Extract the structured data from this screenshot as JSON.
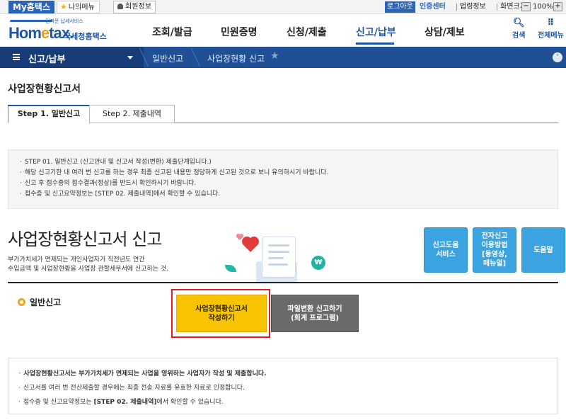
{
  "topbar": {
    "my_hometax": "My홈택스",
    "my_menu": "나의메뉴",
    "member_info": "회원정보",
    "logout": "로그아웃",
    "cert_center": "인증센터",
    "law_info": "법령정보",
    "screen_size": "화면크기",
    "zoom_out": "−",
    "zoom_value": "100%",
    "zoom_in": "+"
  },
  "header": {
    "logo_small": "전자문 납세서비스",
    "logo_main_pre": "Hom",
    "logo_main_e": "e",
    "logo_main_post": "tax.",
    "logo_sub": "국세청홈택스",
    "nav": [
      "조회/발급",
      "민원증명",
      "신청/제출",
      "신고/납부",
      "상담/제보"
    ],
    "search_label": "검색",
    "all_menu_label": "전체메뉴",
    "active_color": "#1f57a6"
  },
  "location": {
    "menu_title": "신고/납부",
    "crumb1": "일반신고",
    "crumb2": "사업장현황 신고",
    "expand_icon": "˅"
  },
  "page": {
    "title": "사업장현황신고서",
    "tabs": [
      {
        "label": "Step 1. 일반신고",
        "active": true
      },
      {
        "label": "Step 2. 제출내역",
        "active": false
      }
    ]
  },
  "info": {
    "lines": [
      "STEP 01. 일반신고 (신고안내 및 신고서 작성(변환) 제출단계입니다.)",
      "해당 신고기한 내 여러 번 신고를 하는 경우 최종 신고된 내용만 정당하게 신고된 것으로 보니 유의하시기 바랍니다.",
      "신고 후 접수증의 접수결과(정상)를 반드시 확인하시기 바랍니다.",
      "접수증 및 신고요약정보는 [STEP 02. 제출내역]에서 확인할 수 있습니다."
    ]
  },
  "hero": {
    "title": "사업장현황신고서 신고",
    "desc_line1": "부가가치세가 면제되는 개인사업자가 직전년도 연간",
    "desc_line2": "수입금액 및 사업장현황을 사업장 관할세무서에 신고하는 것.",
    "coin_symbol": "₩",
    "side_buttons": [
      "신고도움\n서비스",
      "전자신고\n이용방법\n[동영상,\n매뉴얼]",
      "도움말"
    ],
    "accent_color": "#3aa3e0"
  },
  "filing": {
    "section_label": "일반신고",
    "write_button": "사업장현황신고서\n작성하기",
    "convert_button": "파일변환 신고하기\n(회계 프로그램)",
    "highlight_color": "#e41e1e",
    "write_color": "#f8c300"
  },
  "notice": {
    "line1": "사업장현황신고서는 부가가치세가 면제되는 사업을 영위하는 사업자가 작성 및 제출합니다.",
    "line2": "신고서를 여러 번 전산제출할 경우에는 최종 전송 자료를 유효한 자료로 인정합니다.",
    "line3_pre": "접수증 및 신고요약정보는 ",
    "line3_bold": "[STEP 02. 제출내역]",
    "line3_post": "에서 확인할 수 있습니다."
  }
}
